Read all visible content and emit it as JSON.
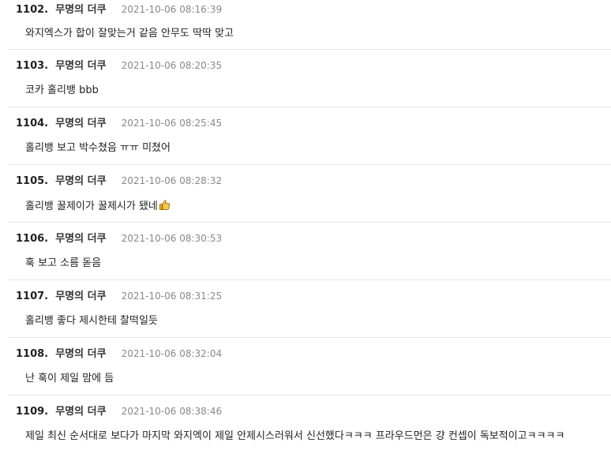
{
  "comments": [
    {
      "num": "1102.",
      "author": "무명의 더쿠",
      "date": "2021-10-06 08:16:39",
      "text": "와지엑스가 합이 잘맞는거 같음 안무도 딱딱 맞고"
    },
    {
      "num": "1103.",
      "author": "무명의 더쿠",
      "date": "2021-10-06 08:20:35",
      "text": "코카 홀리뱅 bbb"
    },
    {
      "num": "1104.",
      "author": "무명의 더쿠",
      "date": "2021-10-06 08:25:45",
      "text": "홀리뱅 보고 박수쳤음 ㅠㅠ 미쳤어"
    },
    {
      "num": "1105.",
      "author": "무명의 더쿠",
      "date": "2021-10-06 08:28:32",
      "text": "홀리뱅 꿀제이가 꿀제시가 됐네",
      "icon": "thumbs-up-icon"
    },
    {
      "num": "1106.",
      "author": "무명의 더쿠",
      "date": "2021-10-06 08:30:53",
      "text": "훅 보고 소름 돋음"
    },
    {
      "num": "1107.",
      "author": "무명의 더쿠",
      "date": "2021-10-06 08:31:25",
      "text": "홀리뱅 좋다 제시한테 찰떡일듯"
    },
    {
      "num": "1108.",
      "author": "무명의 더쿠",
      "date": "2021-10-06 08:32:04",
      "text": "난 훅이 제일 맘에 듬"
    },
    {
      "num": "1109.",
      "author": "무명의 더쿠",
      "date": "2021-10-06 08:38:46",
      "text": "제일 최신 순서대로 보다가 마지막 와지엑이 제일 안제시스러워서 신선했다ㅋㅋㅋ 프라우드먼은 걍 컨셉이 독보적이고ㅋㅋㅋㅋ"
    }
  ]
}
